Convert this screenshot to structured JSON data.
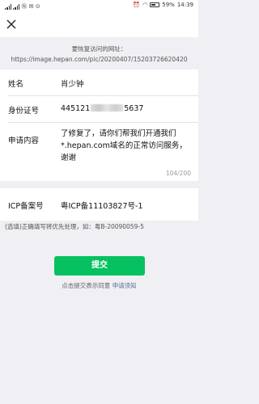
{
  "status_bar": {
    "left_indicators": "Ⓝ ✉ ⊙",
    "battery_percent": "59%",
    "time": "14:39"
  },
  "header": {
    "close_icon": "close-icon"
  },
  "url_section": {
    "title": "要恢复访问的网址：",
    "url": "https://image.hepan.com/pic/20200407/15203726620420"
  },
  "form": {
    "name": {
      "label": "姓名",
      "value": "肖少钟"
    },
    "id_number": {
      "label": "身份证号",
      "value_prefix": "445121",
      "value_suffix": "5637"
    },
    "reason": {
      "label": "申请内容",
      "value": "了修复了，请你们帮我们开通我们*.hepan.com域名的正常访问服务，谢谢",
      "counter": "104/200"
    },
    "icp": {
      "label": "ICP备案号",
      "value": "粤ICP备11103827号-1"
    }
  },
  "hint": "(选填)正确填写将优先处理，如：粤B-20090059-5",
  "submit_label": "提交",
  "agreement": {
    "prefix": "点击提交表示同意",
    "link": "申请须知"
  },
  "colors": {
    "accent": "#07c160",
    "link": "#576b95"
  }
}
